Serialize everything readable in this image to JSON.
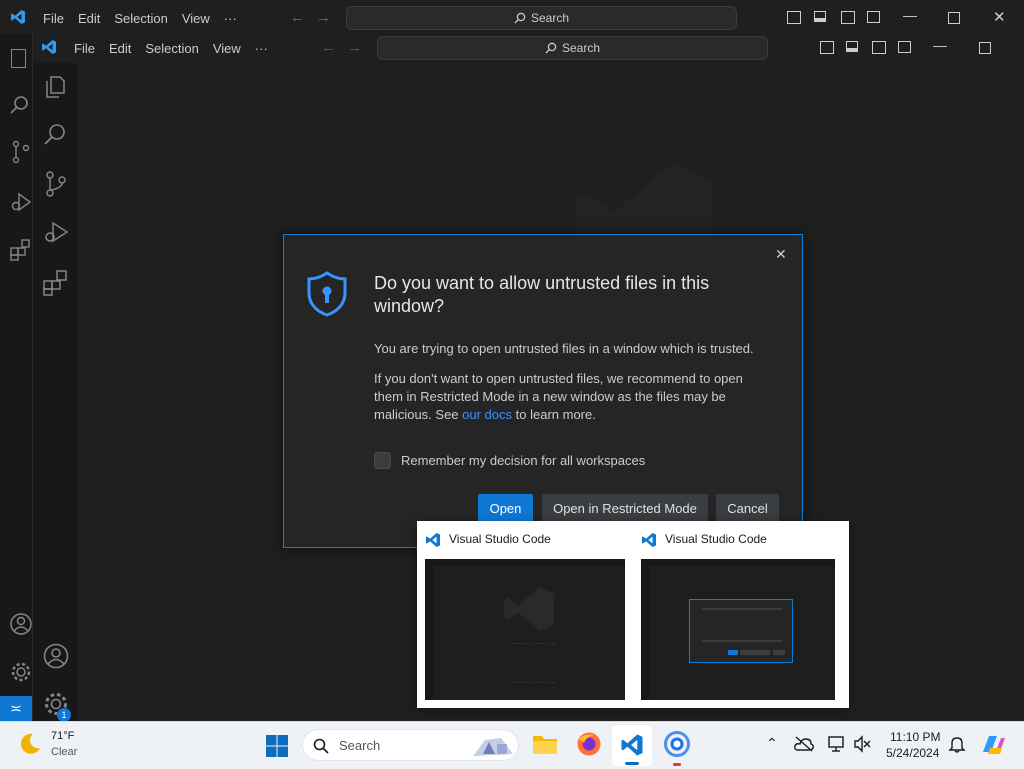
{
  "back_window": {
    "menu": [
      "File",
      "Edit",
      "Selection",
      "View",
      "···"
    ],
    "search_label": "Search"
  },
  "front_window": {
    "menu": [
      "File",
      "Edit",
      "Selection",
      "View",
      "···"
    ],
    "search_label": "Search"
  },
  "dialog": {
    "title": "Do you want to allow untrusted files in this window?",
    "line1": "You are trying to open untrusted files in a window which is trusted.",
    "line2_before": "If you don't want to open untrusted files, we recommend to open them in Restricted Mode in a new window as the files may be malicious. See ",
    "line2_link": "our docs",
    "line2_after": " to learn more.",
    "checkbox_label": "Remember my decision for all workspaces",
    "btn_open": "Open",
    "btn_restricted": "Open in Restricted Mode",
    "btn_cancel": "Cancel",
    "close_glyph": "✕"
  },
  "activity_badge": "1",
  "previews": [
    {
      "title": "Visual Studio Code"
    },
    {
      "title": "Visual Studio Code"
    }
  ],
  "taskbar": {
    "weather_temp": "71°F",
    "weather_desc": "Clear",
    "search_label": "Search",
    "time": "11:10 PM",
    "date": "5/24/2024"
  },
  "colors": {
    "accent": "#0e78d4",
    "link": "#3794ff",
    "editor_bg": "#1f1f1f"
  }
}
